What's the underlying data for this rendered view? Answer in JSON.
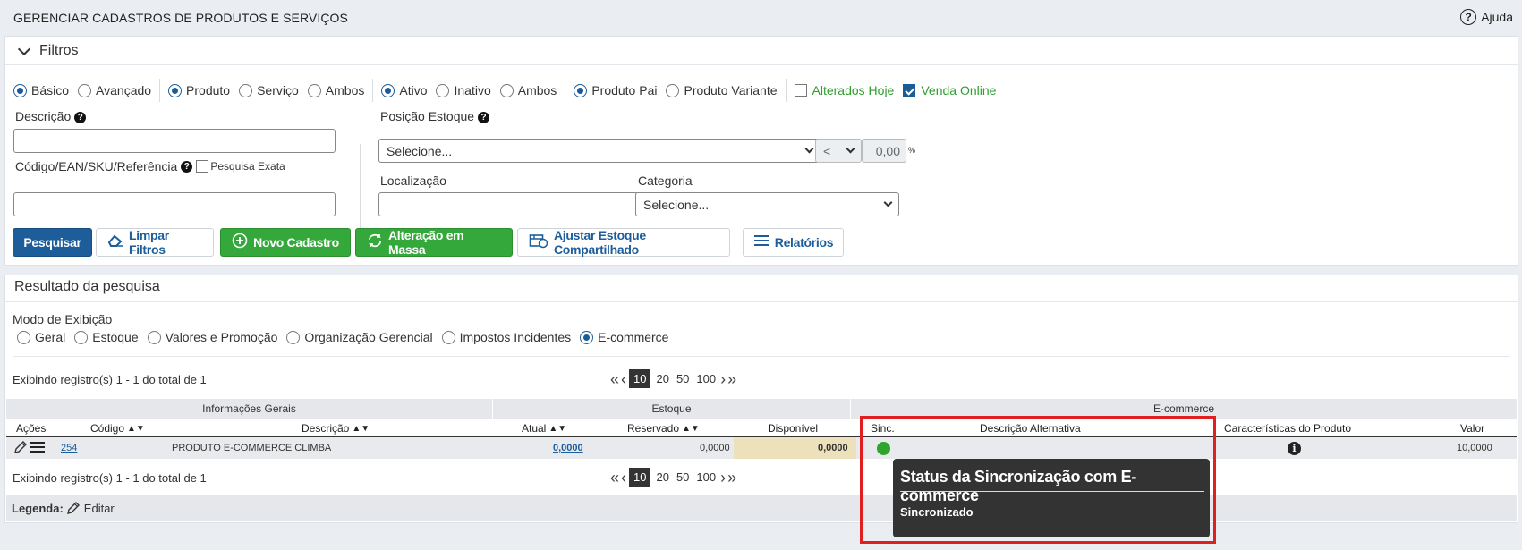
{
  "header": {
    "title": "GERENCIAR CADASTROS DE PRODUTOS E SERVIÇOS",
    "help_label": "Ajuda"
  },
  "filters": {
    "title": "Filtros",
    "groups": [
      {
        "options": [
          {
            "label": "Básico",
            "selected": true
          },
          {
            "label": "Avançado",
            "selected": false
          }
        ]
      },
      {
        "options": [
          {
            "label": "Produto",
            "selected": true
          },
          {
            "label": "Serviço",
            "selected": false
          },
          {
            "label": "Ambos",
            "selected": false
          }
        ]
      },
      {
        "options": [
          {
            "label": "Ativo",
            "selected": true
          },
          {
            "label": "Inativo",
            "selected": false
          },
          {
            "label": "Ambos",
            "selected": false
          }
        ]
      },
      {
        "options": [
          {
            "label": "Produto Pai",
            "selected": true
          },
          {
            "label": "Produto Variante",
            "selected": false
          }
        ]
      }
    ],
    "alterados_hoje": {
      "label": "Alterados Hoje",
      "checked": false
    },
    "venda_online": {
      "label": "Venda Online",
      "checked": true
    },
    "descricao_label": "Descrição",
    "codigo_label": "Código/EAN/SKU/Referência",
    "pesquisa_exata_label": "Pesquisa Exata",
    "posicao_estoque_label": "Posição Estoque",
    "posicao_select": "Selecione...",
    "operator_select": "<",
    "quantity_value": "0,00",
    "percent_symbol": "%",
    "localizacao_label": "Localização",
    "categoria_label": "Categoria",
    "categoria_select": "Selecione..."
  },
  "buttons": {
    "pesquisar": "Pesquisar",
    "limpar": "Limpar Filtros",
    "novo": "Novo Cadastro",
    "alteracao": "Alteração em Massa",
    "ajustar": "Ajustar Estoque Compartilhado",
    "relatorios": "Relatórios"
  },
  "results": {
    "title": "Resultado da pesquisa",
    "mode_label": "Modo de Exibição",
    "modes": [
      {
        "label": "Geral",
        "selected": false
      },
      {
        "label": "Estoque",
        "selected": false
      },
      {
        "label": "Valores e Promoção",
        "selected": false
      },
      {
        "label": "Organização Gerencial",
        "selected": false
      },
      {
        "label": "Impostos Incidentes",
        "selected": false
      },
      {
        "label": "E-commerce",
        "selected": true
      }
    ],
    "records_text": "Exibindo registro(s) 1 - 1 do total de 1",
    "page_sizes": [
      "10",
      "20",
      "50",
      "100"
    ],
    "group_headers": {
      "info": "Informações Gerais",
      "estoque": "Estoque",
      "ecommerce": "E-commerce"
    },
    "columns": {
      "acoes": "Ações",
      "codigo": "Código",
      "descricao": "Descrição",
      "atual": "Atual",
      "reservado": "Reservado",
      "disponivel": "Disponível",
      "sinc": "Sinc.",
      "desc_alt": "Descrição Alternativa",
      "caracteristicas": "Características do Produto",
      "valor": "Valor"
    },
    "row": {
      "codigo": "254",
      "descricao": "PRODUTO E-COMMERCE CLIMBA",
      "atual": "0,0000",
      "reservado": "0,0000",
      "disponivel": "0,0000",
      "valor": "10,0000"
    },
    "legend_label": "Legenda:",
    "legend_edit": "Editar"
  },
  "tooltip": {
    "title": "Status da Sincronização com E-commerce",
    "body": "Sincronizado"
  },
  "colors": {
    "primary": "#1c5d9a",
    "success": "#34a83a",
    "highlight": "#e02020",
    "sync_ok": "#2fa52f"
  }
}
